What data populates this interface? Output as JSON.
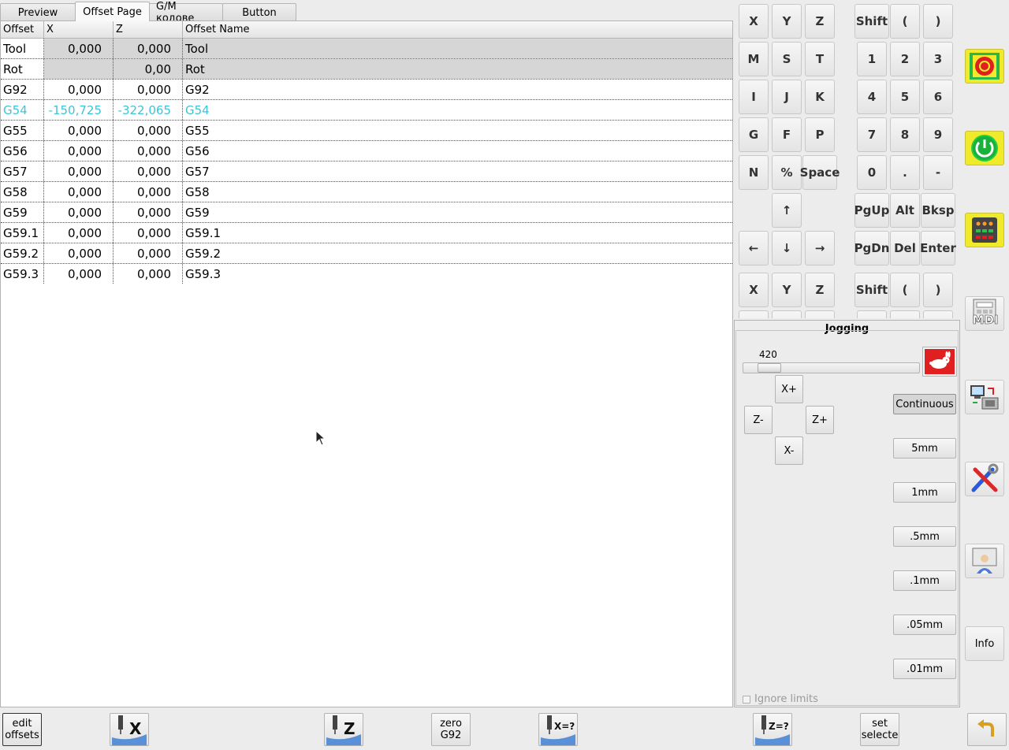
{
  "tabs": [
    {
      "label": "Preview"
    },
    {
      "label": "Offset Page"
    },
    {
      "label": "G/M кодове"
    },
    {
      "label": "Button"
    }
  ],
  "offsets_table": {
    "headers": [
      "Offset",
      "X",
      "Z",
      "Offset Name"
    ],
    "rows": [
      {
        "offset": "Tool",
        "x": "0,000",
        "z": "0,000",
        "name": "Tool"
      },
      {
        "offset": "Rot",
        "x": "",
        "z": "0,00",
        "name": "Rot"
      },
      {
        "offset": "G92",
        "x": "0,000",
        "z": "0,000",
        "name": "G92"
      },
      {
        "offset": "G54",
        "x": "-150,725",
        "z": "-322,065",
        "name": "G54"
      },
      {
        "offset": "G55",
        "x": "0,000",
        "z": "0,000",
        "name": "G55"
      },
      {
        "offset": "G56",
        "x": "0,000",
        "z": "0,000",
        "name": "G56"
      },
      {
        "offset": "G57",
        "x": "0,000",
        "z": "0,000",
        "name": "G57"
      },
      {
        "offset": "G58",
        "x": "0,000",
        "z": "0,000",
        "name": "G58"
      },
      {
        "offset": "G59",
        "x": "0,000",
        "z": "0,000",
        "name": "G59"
      },
      {
        "offset": "G59.1",
        "x": "0,000",
        "z": "0,000",
        "name": "G59.1"
      },
      {
        "offset": "G59.2",
        "x": "0,000",
        "z": "0,000",
        "name": "G59.2"
      },
      {
        "offset": "G59.3",
        "x": "0,000",
        "z": "0,000",
        "name": "G59.3"
      }
    ],
    "active_color": "#3cc4d8"
  },
  "keyboard": {
    "r1": [
      "X",
      "Y",
      "Z",
      "Shift",
      "(",
      ")"
    ],
    "r2": [
      "M",
      "S",
      "T",
      "1",
      "2",
      "3"
    ],
    "r3": [
      "I",
      "J",
      "K",
      "4",
      "5",
      "6"
    ],
    "r4": [
      "G",
      "F",
      "P",
      "7",
      "8",
      "9"
    ],
    "r5": [
      "N",
      "%",
      "Space",
      "0",
      ".",
      "-"
    ],
    "r6": [
      "↑",
      "PgUp",
      "Alt",
      "Bksp"
    ],
    "r7": [
      "←",
      "↓",
      "→",
      "PgDn",
      "Del",
      "Enter"
    ],
    "r8": [
      "X",
      "Y",
      "Z",
      "Shift",
      "(",
      ")"
    ]
  },
  "jogging": {
    "title": "Jogging",
    "speed": "420",
    "speed_fraction": 0.09,
    "x_plus": "X+",
    "x_minus": "X-",
    "z_minus": "Z-",
    "z_plus": "Z+",
    "increments": [
      "Continuous",
      "5mm",
      "1mm",
      ".5mm",
      ".1mm",
      ".05mm",
      ".01mm"
    ],
    "selected_increment": "Continuous",
    "ignore_limits": "Ignore limits"
  },
  "sidebar": {
    "mdi": "MDI",
    "info": "Info",
    "estop_color": "#ff0000",
    "power_color": "#22cc44",
    "highlight_color": "#f1ea2a"
  },
  "bottom": {
    "edit_offsets": [
      "edit",
      "offsets"
    ],
    "touch_x": "X",
    "touch_z": "Z",
    "zero_g92": [
      "zero",
      "G92"
    ],
    "x_query": "X=?",
    "z_query": "Z=?",
    "set_selected": [
      "set",
      "selecte"
    ]
  }
}
